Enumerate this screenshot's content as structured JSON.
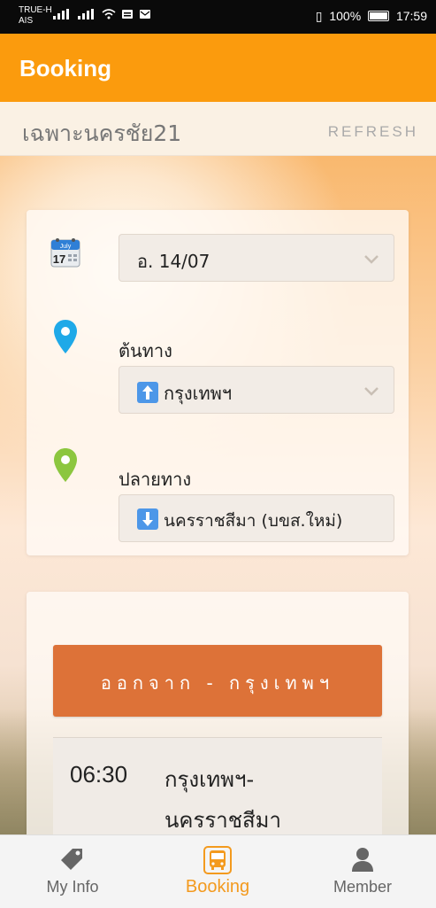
{
  "statusbar": {
    "carrier_line1": "TRUE-H",
    "carrier_line2": "AIS",
    "battery": "100%",
    "time": "17:59"
  },
  "appbar": {
    "title": "Booking"
  },
  "subheader": {
    "title": "เฉพาะนครชัย21",
    "refresh": "REFRESH"
  },
  "form": {
    "date_value": "อ. 14/07",
    "calendar_month": "July",
    "calendar_day": "17",
    "origin_label": "ต้นทาง",
    "origin_value": "กรุงเทพฯ",
    "destination_label": "ปลายทาง",
    "destination_value": "นครราชสีมา (บขส.ใหม่)"
  },
  "departure": {
    "button_label": "ออกจาก - กรุงเทพฯ",
    "trips": [
      {
        "time": "06:30",
        "route": "กรุงเทพฯ-นครราชสีมา"
      }
    ]
  },
  "bottomnav": {
    "items": [
      {
        "label": "My Info",
        "icon": "tag-icon"
      },
      {
        "label": "Booking",
        "icon": "bus-icon"
      },
      {
        "label": "Member",
        "icon": "person-icon"
      }
    ]
  },
  "colors": {
    "appbar": "#fb9b0d",
    "accent": "#f39a1e",
    "button": "#dd7238"
  }
}
